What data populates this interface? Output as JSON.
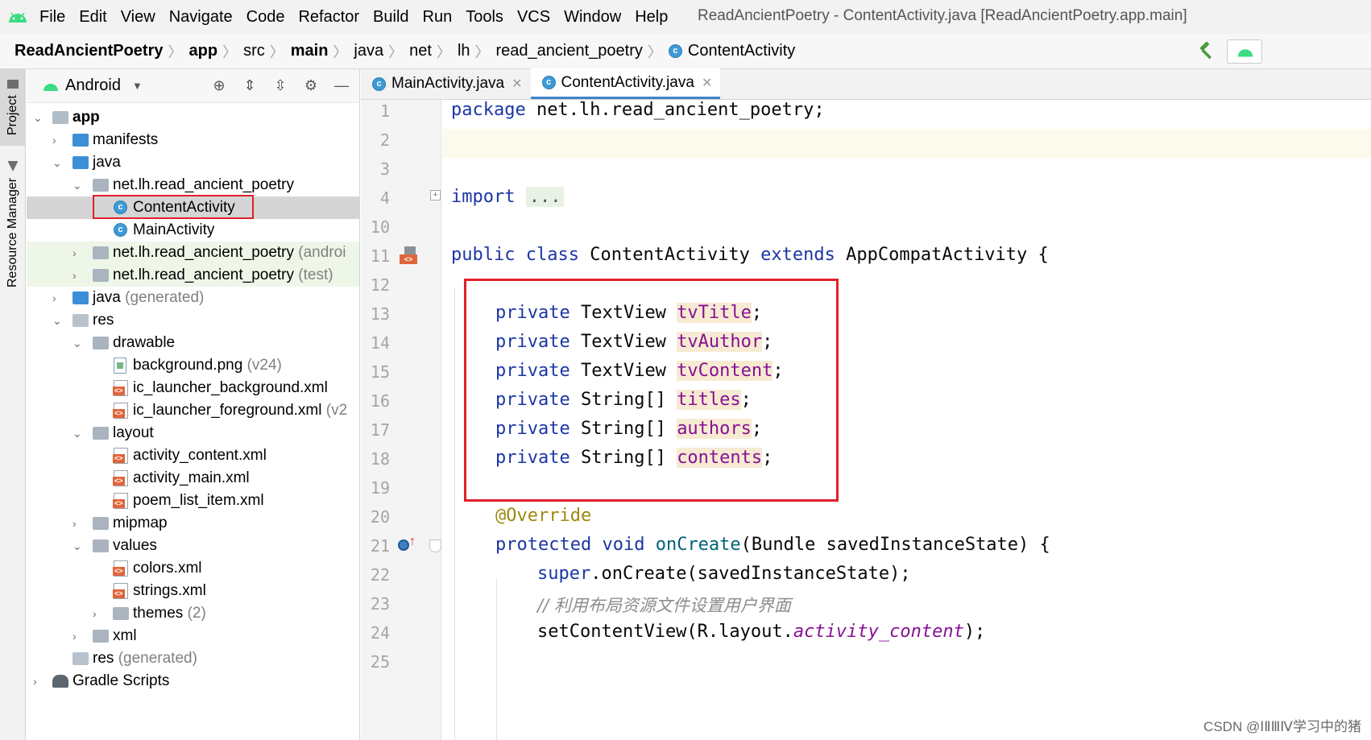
{
  "menubar": {
    "items": [
      "File",
      "Edit",
      "View",
      "Navigate",
      "Code",
      "Refactor",
      "Build",
      "Run",
      "Tools",
      "VCS",
      "Window",
      "Help"
    ],
    "window_title": "ReadAncientPoetry - ContentActivity.java [ReadAncientPoetry.app.main]"
  },
  "breadcrumb": {
    "items": [
      "ReadAncientPoetry",
      "app",
      "src",
      "main",
      "java",
      "net",
      "lh",
      "read_ancient_poetry",
      "ContentActivity"
    ]
  },
  "tool_stripe": {
    "project_tab": "Project",
    "resource_tab": "Resource Manager"
  },
  "project_panel": {
    "view_mode": "Android",
    "tree": [
      {
        "label": "app",
        "hint": ""
      },
      {
        "label": "manifests",
        "hint": ""
      },
      {
        "label": "java",
        "hint": ""
      },
      {
        "label": "net.lh.read_ancient_poetry",
        "hint": ""
      },
      {
        "label": "ContentActivity",
        "hint": ""
      },
      {
        "label": "MainActivity",
        "hint": ""
      },
      {
        "label": "net.lh.read_ancient_poetry",
        "hint": "(androi"
      },
      {
        "label": "net.lh.read_ancient_poetry",
        "hint": "(test)"
      },
      {
        "label": "java",
        "hint": "(generated)"
      },
      {
        "label": "res",
        "hint": ""
      },
      {
        "label": "drawable",
        "hint": ""
      },
      {
        "label": "background.png",
        "hint": "(v24)"
      },
      {
        "label": "ic_launcher_background.xml",
        "hint": ""
      },
      {
        "label": "ic_launcher_foreground.xml",
        "hint": "(v2"
      },
      {
        "label": "layout",
        "hint": ""
      },
      {
        "label": "activity_content.xml",
        "hint": ""
      },
      {
        "label": "activity_main.xml",
        "hint": ""
      },
      {
        "label": "poem_list_item.xml",
        "hint": ""
      },
      {
        "label": "mipmap",
        "hint": ""
      },
      {
        "label": "values",
        "hint": ""
      },
      {
        "label": "colors.xml",
        "hint": ""
      },
      {
        "label": "strings.xml",
        "hint": ""
      },
      {
        "label": "themes",
        "hint": "(2)"
      },
      {
        "label": "xml",
        "hint": ""
      },
      {
        "label": "res",
        "hint": "(generated)"
      },
      {
        "label": "Gradle Scripts",
        "hint": ""
      }
    ]
  },
  "editor_tabs": [
    {
      "label": "MainActivity.java",
      "active": false
    },
    {
      "label": "ContentActivity.java",
      "active": true
    }
  ],
  "editor": {
    "line_numbers": [
      "1",
      "2",
      "3",
      "4",
      "10",
      "11",
      "12",
      "13",
      "14",
      "15",
      "16",
      "17",
      "18",
      "19",
      "20",
      "21",
      "22",
      "23",
      "24",
      "25"
    ],
    "code": {
      "l1_kw": "package",
      "l1_rest": " net.lh.read_ancient_poetry;",
      "l4_kw": "import",
      "l4_fold": "...",
      "l11_kw1": "public",
      "l11_kw2": "class",
      "l11_name": "ContentActivity",
      "l11_kw3": "extends",
      "l11_super": "AppCompatActivity {",
      "private_kw": "private",
      "fields": [
        {
          "type": "TextView",
          "name": "tvTitle"
        },
        {
          "type": "TextView",
          "name": "tvAuthor"
        },
        {
          "type": "TextView",
          "name": "tvContent"
        },
        {
          "type": "String[]",
          "name": "titles"
        },
        {
          "type": "String[]",
          "name": "authors"
        },
        {
          "type": "String[]",
          "name": "contents"
        }
      ],
      "semicolon": ";",
      "l20_ann": "@Override",
      "l21_kw1": "protected",
      "l21_kw2": "void",
      "l21_method": "onCreate",
      "l21_rest": "(Bundle savedInstanceState) {",
      "l22_kw": "super",
      "l22_rest": ".onCreate(savedInstanceState);",
      "l23_comment": "// 利用布局资源文件设置用户界面",
      "l24_a": "setContentView(R.layout.",
      "l24_field": "activity_content",
      "l24_b": ");"
    }
  },
  "watermark": "CSDN @ⅠⅡⅢⅣ学习中的猪",
  "colors": {
    "accent": "#4083c9",
    "highlight_box": "#e0202a",
    "keyword": "#1b36a6",
    "field": "#871094"
  }
}
